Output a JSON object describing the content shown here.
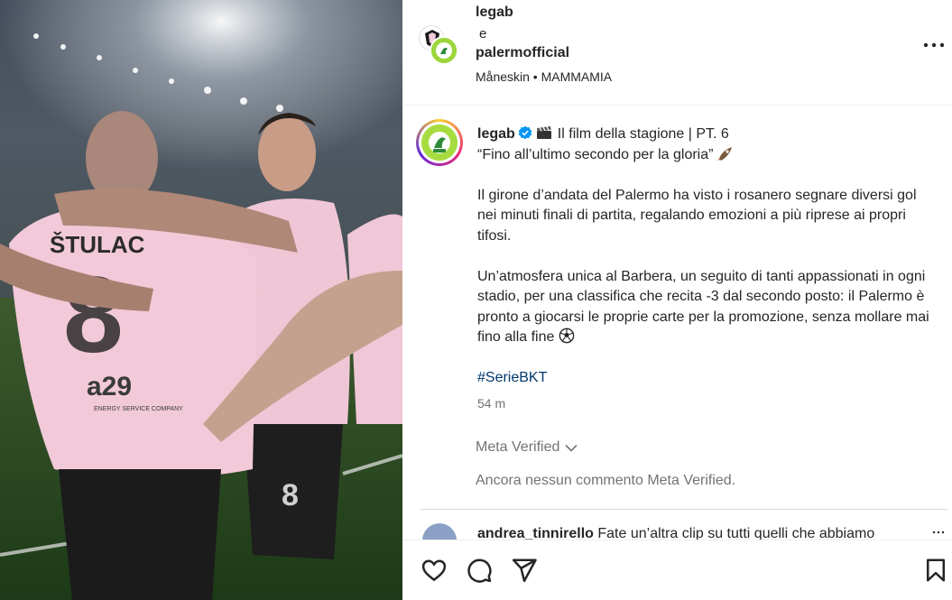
{
  "header": {
    "user1": "legab",
    "conjunction": "e",
    "user2": "palermofficial",
    "audio": "Måneskin • MAMMAMIA"
  },
  "media": {
    "jersey_name": "ŠTULAC",
    "sponsor": "a29",
    "sponsor_sub": "ENERGY SERVICE COMPANY",
    "shorts_number": "8"
  },
  "caption": {
    "username": "legab",
    "line1": "Il film della stagione | PT. 6",
    "line2": "“Fino all’ultimo secondo per la gloria”",
    "para1": "Il girone d’andata del Palermo ha visto i rosanero segnare diversi gol nei minuti finali di partita, regalando emozioni a più riprese ai propri tifosi.",
    "para2": "Un’atmosfera unica al Barbera, un seguito di tanti appassionati in ogni stadio, per una classifica che recita -3 dal secondo posto: il Palermo è pronto a giocarsi le proprie carte per la promozione, senza mollare mai fino alla fine",
    "hashtag": "#SerieBKT"
  },
  "time": "54 m",
  "meta_verified_label": "Meta Verified",
  "no_comments": "Ancora nessun commento Meta Verified.",
  "next_comment": {
    "user": "andrea_tinnirello",
    "text": "Fate un’altra clip su tutti quelli che abbiamo"
  },
  "icons": {
    "like": "heart-icon",
    "comment": "comment-icon",
    "share": "send-icon",
    "save": "bookmark-icon",
    "more": "more-horizontal-icon"
  },
  "colors": {
    "verified_blue": "#0095f6",
    "hashtag": "#00376b",
    "muted": "#737373",
    "jersey_pink": "#f2c9d8"
  }
}
